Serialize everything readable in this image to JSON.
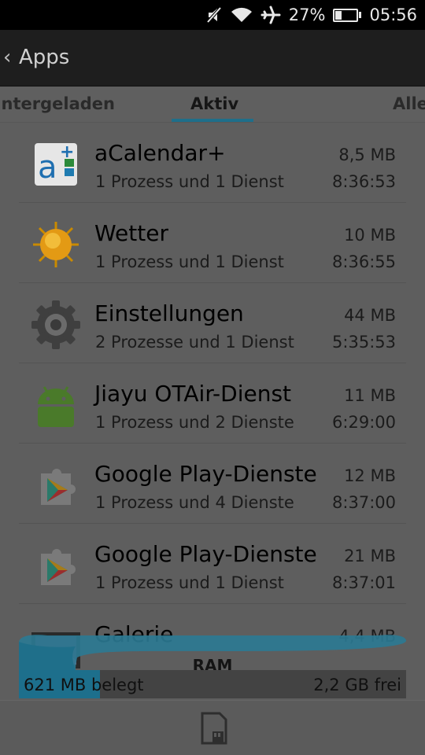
{
  "status_bar": {
    "battery_percent": "27%",
    "battery_level": 0.27,
    "time": "05:56",
    "icons": [
      "mute-icon",
      "wifi-icon",
      "airplane-icon",
      "battery-icon"
    ]
  },
  "action_bar": {
    "back_glyph": "‹",
    "title": "Apps"
  },
  "tabs": [
    {
      "label": "Heruntergeladen",
      "selected": false
    },
    {
      "label": "Aktiv",
      "selected": true
    },
    {
      "label": "Alle",
      "selected": false
    }
  ],
  "apps": [
    {
      "name": "aCalendar+",
      "desc": "1 Prozess und 1 Dienst",
      "size": "8,5 MB",
      "time": "8:36:53",
      "icon": "acalendar-icon"
    },
    {
      "name": "Wetter",
      "desc": "1 Prozess und 1 Dienst",
      "size": "10 MB",
      "time": "8:36:55",
      "icon": "weather-sun-icon"
    },
    {
      "name": "Einstellungen",
      "desc": "2 Prozesse und 1 Dienst",
      "size": "44 MB",
      "time": "5:35:53",
      "icon": "gear-icon"
    },
    {
      "name": "Jiayu OTAir-Dienst",
      "desc": "1 Prozess und 2 Dienste",
      "size": "11 MB",
      "time": "6:29:00",
      "icon": "android-icon"
    },
    {
      "name": "Google Play-Dienste",
      "desc": "1 Prozess und 4 Dienste",
      "size": "12 MB",
      "time": "8:37:00",
      "icon": "play-services-icon"
    },
    {
      "name": "Google Play-Dienste",
      "desc": "1 Prozess und 1 Dienst",
      "size": "21 MB",
      "time": "8:37:01",
      "icon": "play-services-icon"
    },
    {
      "name": "Galerie",
      "desc": "",
      "size": "4,4 MB",
      "time": "",
      "icon": "gallery-icon"
    }
  ],
  "ram": {
    "label": "RAM",
    "used": "621 MB belegt",
    "free": "2,2 GB frei",
    "used_fraction": 0.21
  },
  "bottom_bar": {
    "icon": "sd-card-icon"
  },
  "colors": {
    "accent": "#1f6f8a",
    "list_bg": "#5e5e5e",
    "action_bar_bg": "#1e1e1e"
  }
}
